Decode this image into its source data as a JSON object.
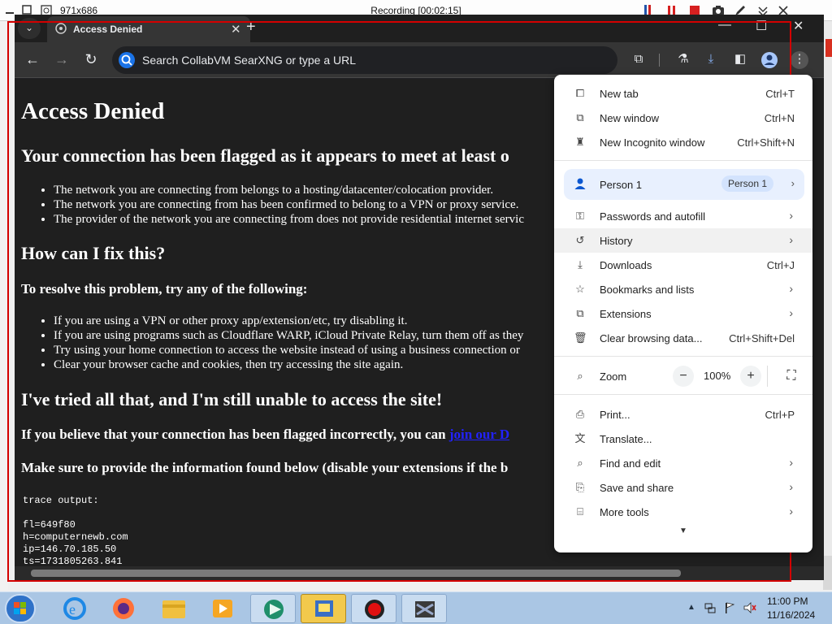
{
  "recorder": {
    "size": "971x686",
    "title": "Recording [00:02:15]"
  },
  "browser": {
    "tab_title": "Access Denied",
    "address_placeholder": "Search CollabVM SearXNG or type a URL"
  },
  "page": {
    "h1": "Access Denied",
    "h2_flagged": "Your connection has been flagged as it appears to meet at least o",
    "reasons": [
      "The network you are connecting from belongs to a hosting/datacenter/colocation provider.",
      "The network you are connecting from has been confirmed to belong to a VPN or proxy service.",
      "The provider of the network you are connecting from does not provide residential internet servic"
    ],
    "h2_fix": "How can I fix this?",
    "h3_resolve": "To resolve this problem, try any of the following:",
    "fixes": [
      "If you are using a VPN or other proxy app/extension/etc, try disabling it.",
      "If you are using programs such as Cloudflare WARP, iCloud Private Relay, turn them off as they",
      "Try using your home connection to access the website instead of using a business connection or",
      "Clear your browser cache and cookies, then try accessing the site again."
    ],
    "h2_tried": "I've tried all that, and I'm still unable to access the site!",
    "h3_believe": "If you believe that your connection has been flagged incorrectly, you can",
    "h3_believe_link": "join our D",
    "h3_provide": "Make sure to provide the information found below (disable your extensions if the b",
    "trace_label": "trace output:",
    "trace_lines": [
      "fl=649f80",
      "h=computernewb.com",
      "ip=146.70.185.50",
      "ts=1731805263.841"
    ]
  },
  "menu": {
    "new_tab": "New tab",
    "new_tab_sc": "Ctrl+T",
    "new_window": "New window",
    "new_window_sc": "Ctrl+N",
    "incognito": "New Incognito window",
    "incognito_sc": "Ctrl+Shift+N",
    "person": "Person 1",
    "person_badge": "Person 1",
    "passwords": "Passwords and autofill",
    "history": "History",
    "downloads": "Downloads",
    "downloads_sc": "Ctrl+J",
    "bookmarks": "Bookmarks and lists",
    "extensions": "Extensions",
    "clear": "Clear browsing data...",
    "clear_sc": "Ctrl+Shift+Del",
    "zoom": "Zoom",
    "zoom_level": "100%",
    "print": "Print...",
    "print_sc": "Ctrl+P",
    "translate": "Translate...",
    "find": "Find and edit",
    "save": "Save and share",
    "more_tools": "More tools"
  },
  "taskbar": {
    "time": "11:00 PM",
    "date": "11/16/2024"
  },
  "colors": {
    "recording_frame": "#d40000",
    "accent": "#1a73e8"
  }
}
